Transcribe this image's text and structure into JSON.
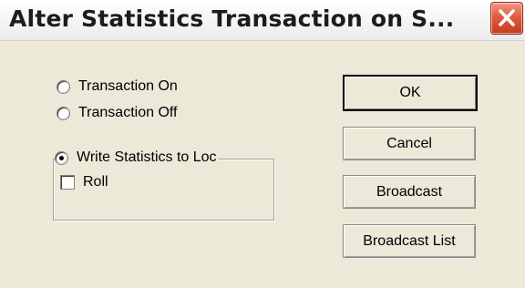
{
  "window": {
    "title": "Alter Statistics Transaction on S...",
    "close_icon": "close-icon"
  },
  "options": {
    "transaction_on": "Transaction On",
    "transaction_off": "Transaction Off",
    "write_stats": "Write Statistics to Loc",
    "roll": "Roll"
  },
  "state": {
    "selected_radio": "write_stats",
    "roll_checked": false
  },
  "buttons": {
    "ok": "OK",
    "cancel": "Cancel",
    "broadcast": "Broadcast",
    "broadcast_list": "Broadcast List"
  },
  "colors": {
    "dialog_bg": "#ece9d8",
    "close_red": "#e15b3f"
  }
}
